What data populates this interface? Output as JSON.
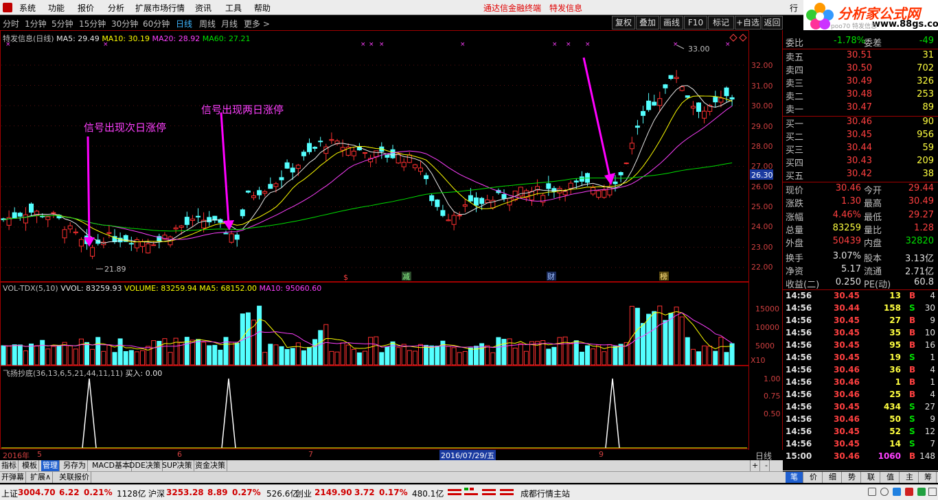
{
  "menu": {
    "items": [
      "系统",
      "功能",
      "报价",
      "分析",
      "扩展市场行情",
      "资讯",
      "工具",
      "帮助"
    ],
    "brand": "通达信金融终端",
    "title": "特发信息",
    "right": "行"
  },
  "logo": {
    "text": "分析家公式网",
    "url": "www.88gs.com",
    "sub": "poo70 特发信息"
  },
  "toolbar": {
    "timeframes": [
      "分时",
      "1分钟",
      "5分钟",
      "15分钟",
      "30分钟",
      "60分钟",
      "日线",
      "周线",
      "月线",
      "更多 >"
    ],
    "active": "日线",
    "buttons": [
      "复权",
      "叠加",
      "画线",
      "F10",
      "标记",
      "+自选",
      "返回"
    ]
  },
  "main_chart": {
    "legend": {
      "name": "特发信息(日线)",
      "ma5": "MA5: 29.49",
      "ma10": "MA10: 30.19",
      "ma20": "MA20: 28.92",
      "ma60": "MA60: 27.21"
    },
    "price_ticks": [
      "32.00",
      "31.00",
      "30.00",
      "29.00",
      "28.00",
      "27.00",
      "26.00",
      "25.00",
      "24.00",
      "23.00",
      "22.00"
    ],
    "current_price_box": "26.30",
    "high_label": "33.00",
    "low_label": "21.89",
    "annotations": [
      "信号出现次日涨停",
      "信号出现两日涨停"
    ],
    "event_markers": [
      "$",
      "减",
      "财",
      "榜"
    ]
  },
  "vol_chart": {
    "legend": {
      "name": "VOL-TDX(5,10)",
      "vvol": "VVOL: 83259.93",
      "volume": "VOLUME: 83259.94",
      "ma5": "MA5: 68152.00",
      "ma10": "MA10: 95060.60"
    },
    "ticks": [
      "15000",
      "10000",
      "5000"
    ],
    "unit": "X10"
  },
  "ind_chart": {
    "legend": {
      "name": "飞扬抄底(36,13,6,5,21,44,11,11)",
      "buy": "买入: 0.00"
    },
    "ticks": [
      "1.00",
      "0.75",
      "0.50"
    ]
  },
  "date_axis": {
    "year": "2016年",
    "months": [
      "5",
      "6",
      "7",
      "9"
    ],
    "cursor_date": "2016/07/29/五",
    "period": "日线"
  },
  "bottom_tabs": {
    "row1": [
      "指标",
      "模板",
      "管理",
      "另存为",
      "MACD基本",
      "DDE决策",
      "SUP决策",
      "资金决策"
    ],
    "row2": [
      "开弹幕",
      "扩展∧",
      "关联报价"
    ],
    "side": [
      "+",
      "-"
    ]
  },
  "quote_panel": {
    "weibi": {
      "label": "委比",
      "value": "-1.78%",
      "label2": "委差",
      "value2": "-49"
    },
    "asks": [
      {
        "label": "卖五",
        "price": "30.51",
        "vol": "31"
      },
      {
        "label": "卖四",
        "price": "30.50",
        "vol": "702"
      },
      {
        "label": "卖三",
        "price": "30.49",
        "vol": "326"
      },
      {
        "label": "卖二",
        "price": "30.48",
        "vol": "253"
      },
      {
        "label": "卖一",
        "price": "30.47",
        "vol": "89"
      }
    ],
    "bids": [
      {
        "label": "买一",
        "price": "30.46",
        "vol": "90"
      },
      {
        "label": "买二",
        "price": "30.45",
        "vol": "956"
      },
      {
        "label": "买三",
        "price": "30.44",
        "vol": "59"
      },
      {
        "label": "买四",
        "price": "30.43",
        "vol": "209"
      },
      {
        "label": "买五",
        "price": "30.42",
        "vol": "38"
      }
    ],
    "stats": [
      {
        "l1": "现价",
        "v1": "30.46",
        "l2": "今开",
        "v2": "29.44",
        "c1": "#ff4040",
        "c2": "#ff4040"
      },
      {
        "l1": "涨跌",
        "v1": "1.30",
        "l2": "最高",
        "v2": "30.49",
        "c1": "#ff4040",
        "c2": "#ff4040"
      },
      {
        "l1": "涨幅",
        "v1": "4.46%",
        "l2": "最低",
        "v2": "29.27",
        "c1": "#ff4040",
        "c2": "#ff4040"
      },
      {
        "l1": "总量",
        "v1": "83259",
        "l2": "量比",
        "v2": "1.28",
        "c1": "#ffff40",
        "c2": "#ff4040"
      },
      {
        "l1": "外盘",
        "v1": "50439",
        "l2": "内盘",
        "v2": "32820",
        "c1": "#ff4040",
        "c2": "#00e000"
      },
      {
        "l1": "换手",
        "v1": "3.07%",
        "l2": "股本",
        "v2": "3.13亿",
        "c1": "#e0e0e0",
        "c2": "#e0e0e0"
      },
      {
        "l1": "净资",
        "v1": "5.17",
        "l2": "流通",
        "v2": "2.71亿",
        "c1": "#e0e0e0",
        "c2": "#e0e0e0"
      },
      {
        "l1": "收益(二)",
        "v1": "0.250",
        "l2": "PE(动)",
        "v2": "60.8",
        "c1": "#e0e0e0",
        "c2": "#e0e0e0"
      }
    ],
    "ticks": [
      {
        "t": "14:56",
        "p": "30.45",
        "v": "13",
        "s": "B",
        "n": "4"
      },
      {
        "t": "14:56",
        "p": "30.44",
        "v": "158",
        "s": "S",
        "n": "30"
      },
      {
        "t": "14:56",
        "p": "30.45",
        "v": "27",
        "s": "B",
        "n": "9"
      },
      {
        "t": "14:56",
        "p": "30.45",
        "v": "35",
        "s": "B",
        "n": "10"
      },
      {
        "t": "14:56",
        "p": "30.45",
        "v": "95",
        "s": "B",
        "n": "16"
      },
      {
        "t": "14:56",
        "p": "30.45",
        "v": "19",
        "s": "S",
        "n": "1"
      },
      {
        "t": "14:56",
        "p": "30.46",
        "v": "36",
        "s": "B",
        "n": "4"
      },
      {
        "t": "14:56",
        "p": "30.46",
        "v": "1",
        "s": "B",
        "n": "1"
      },
      {
        "t": "14:56",
        "p": "30.46",
        "v": "25",
        "s": "B",
        "n": "4"
      },
      {
        "t": "14:56",
        "p": "30.45",
        "v": "434",
        "s": "S",
        "n": "27"
      },
      {
        "t": "14:56",
        "p": "30.46",
        "v": "50",
        "s": "S",
        "n": "9"
      },
      {
        "t": "14:56",
        "p": "30.45",
        "v": "52",
        "s": "S",
        "n": "12"
      },
      {
        "t": "14:56",
        "p": "30.45",
        "v": "14",
        "s": "S",
        "n": "7"
      },
      {
        "t": "15:00",
        "p": "30.46",
        "v": "1060",
        "s": "B",
        "n": "148"
      }
    ],
    "tabs": [
      "笔",
      "价",
      "细",
      "势",
      "联",
      "值",
      "主",
      "筹"
    ]
  },
  "status_bar": {
    "sh": {
      "label": "上证",
      "price": "3004.70",
      "chg": "6.22",
      "pct": "0.21%",
      "amt": "1128亿"
    },
    "hs": {
      "label": "沪深",
      "price": "3253.28",
      "chg": "8.89",
      "pct": "0.27%",
      "amt": "526.6亿"
    },
    "cy": {
      "label": "创业",
      "price": "2149.90",
      "chg": "3.72",
      "pct": "0.17%",
      "amt": "480.1亿"
    },
    "server": "成都行情主站"
  },
  "colors": {
    "up": "#ff3030",
    "down": "#54ffff",
    "ma5": "#e8e8e8",
    "ma10": "#ffff00",
    "ma20": "#ff40ff",
    "ma60": "#00e000",
    "arrow": "#ff00ff"
  }
}
